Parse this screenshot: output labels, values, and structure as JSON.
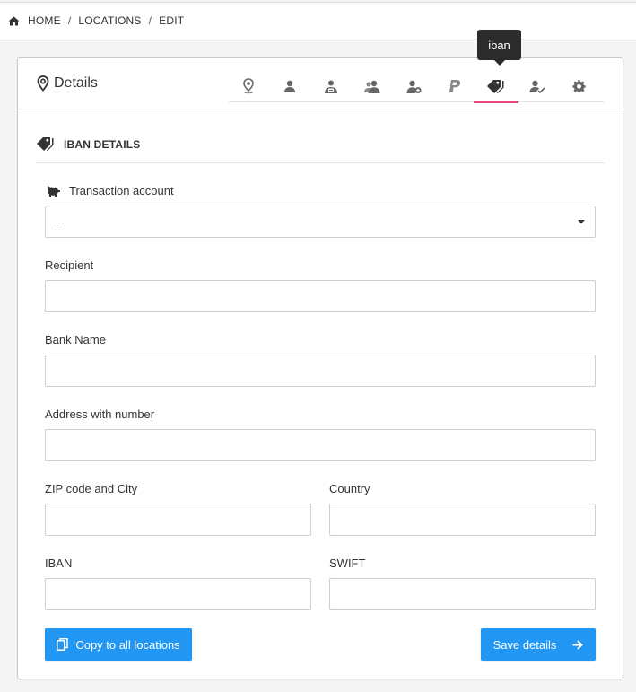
{
  "breadcrumb": {
    "home": "HOME",
    "locations": "LOCATIONS",
    "edit": "EDIT",
    "separator": "/"
  },
  "card": {
    "title": "Details"
  },
  "tabs": [
    {
      "icon": "location-pin-icon"
    },
    {
      "icon": "person-icon"
    },
    {
      "icon": "person-contact-icon"
    },
    {
      "icon": "people-icon"
    },
    {
      "icon": "person-add-icon"
    },
    {
      "icon": "paypal-icon"
    },
    {
      "icon": "price-tags-icon",
      "active": true
    },
    {
      "icon": "person-check-icon"
    },
    {
      "icon": "gear-icon"
    }
  ],
  "tooltip": {
    "text": "iban"
  },
  "section": {
    "title": "IBAN DETAILS"
  },
  "form": {
    "transaction_account": {
      "label": "Transaction account",
      "value": "-"
    },
    "recipient": {
      "label": "Recipient",
      "value": ""
    },
    "bank_name": {
      "label": "Bank Name",
      "value": ""
    },
    "address": {
      "label": "Address with number",
      "value": ""
    },
    "zip_city": {
      "label": "ZIP code and City",
      "value": ""
    },
    "country": {
      "label": "Country",
      "value": ""
    },
    "iban": {
      "label": "IBAN",
      "value": ""
    },
    "swift": {
      "label": "SWIFT",
      "value": ""
    }
  },
  "buttons": {
    "copy": "Copy to all locations",
    "save": "Save details"
  },
  "colors": {
    "primary": "#2196f3",
    "active_tab": "#e2497d",
    "tooltip_bg": "#2b2b2b"
  }
}
